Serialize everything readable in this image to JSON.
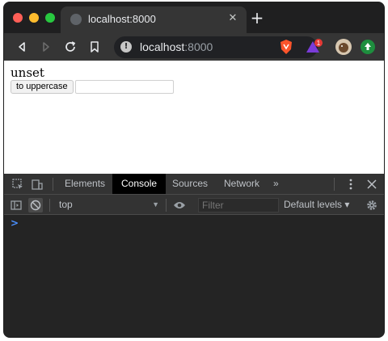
{
  "browser": {
    "tab": {
      "title": "localhost:8000"
    },
    "omnibox": {
      "host": "localhost",
      "port": ":8000"
    },
    "extensions": {
      "badge_count": "1"
    }
  },
  "page": {
    "value_text": "unset",
    "button_label": "to uppercase",
    "input_value": ""
  },
  "devtools": {
    "tabs": [
      {
        "label": "Elements"
      },
      {
        "label": "Console"
      },
      {
        "label": "Sources"
      },
      {
        "label": "Network"
      }
    ],
    "more_tabs": "»",
    "context": "top",
    "filter_placeholder": "Filter",
    "levels_label": "Default levels ▾",
    "prompt": ">"
  },
  "colors": {
    "accent": "#4a90ff",
    "window_frame": "#353535",
    "console_bg": "#242424"
  }
}
